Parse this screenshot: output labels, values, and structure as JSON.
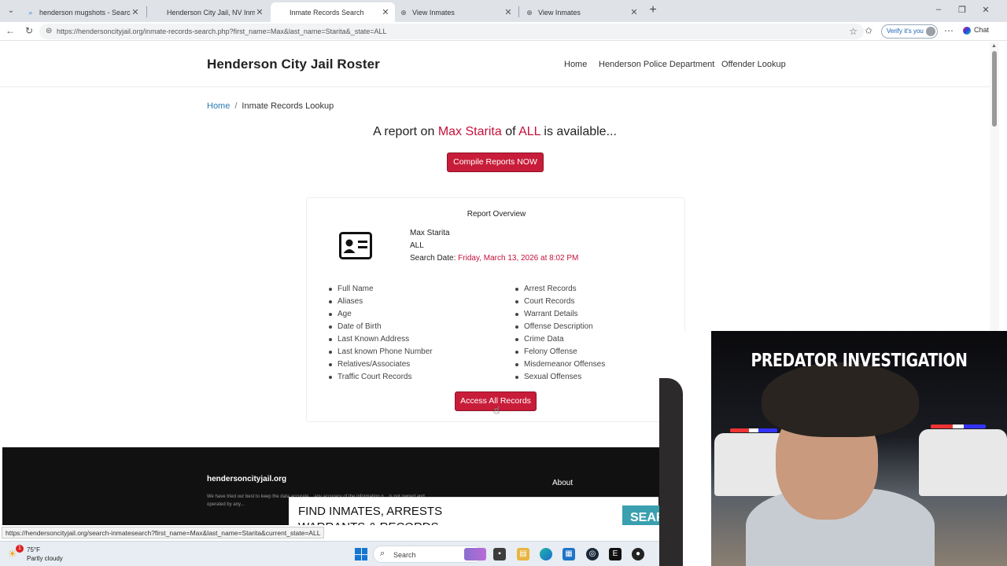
{
  "browser": {
    "tabs": [
      {
        "title": "henderson mugshots - Search",
        "active": false
      },
      {
        "title": "Henderson City Jail, NV Inmate Se",
        "active": false
      },
      {
        "title": "Inmate Records Search",
        "active": true
      },
      {
        "title": "View Inmates",
        "active": false
      },
      {
        "title": "View Inmates",
        "active": false
      }
    ],
    "url": "https://hendersoncityjail.org/inmate-records-search.php?first_name=Max&last_name=Starita&_state=ALL",
    "verify_label": "Verify it's you",
    "chat_label": "Chat",
    "status_url": "https://hendersoncityjail.org/search-inmatesearch?first_name=Max&last_name=Starita&current_state=ALL"
  },
  "site": {
    "title": "Henderson City Jail Roster",
    "nav": [
      "Home",
      "Henderson Police Department",
      "Offender Lookup"
    ]
  },
  "breadcrumb": {
    "home": "Home",
    "separator": "/",
    "current": "Inmate Records Lookup"
  },
  "headline": {
    "prefix": "A report on",
    "name": "Max Starita",
    "of": "of",
    "state": "ALL",
    "suffix": "is available..."
  },
  "compile_button": "Compile Reports NOW",
  "report": {
    "title": "Report Overview",
    "name": "Max Starita",
    "state": "ALL",
    "search_date_label": "Search Date:",
    "search_date_value": "Friday, March 13, 2026 at 8:02 PM",
    "features_left": [
      "Full Name",
      "Aliases",
      "Age",
      "Date of Birth",
      "Last Known Address",
      "Last known Phone Number",
      "Relatives/Associates",
      "Traffic Court Records"
    ],
    "features_right": [
      "Arrest Records",
      "Court Records",
      "Warrant Details",
      "Offense Description",
      "Crime Data",
      "Felony Offense",
      "Misdemeanor Offenses",
      "Sexual Offenses"
    ],
    "access_button": "Access All Records"
  },
  "footer": {
    "site": "hendersoncityjail.org",
    "disclaimer": "We have tried our best to keep the data accurate... any accuracy of the information p... is not owned and operated by any...",
    "about": "About"
  },
  "ad": {
    "text": "FIND INMATES, ARRESTS WARRANTS & RECORDS",
    "button": "SEAR"
  },
  "webcam": {
    "title": "PREDATOR INVESTIGATION"
  },
  "taskbar": {
    "temp": "75°F",
    "condition": "Partly cloudy",
    "badge": "1",
    "search": "Search"
  },
  "colors": {
    "accent_red": "#c81d3a",
    "link_blue": "#2a7ab0",
    "highlight_red": "#c3123a",
    "footer_bg": "#111111"
  }
}
